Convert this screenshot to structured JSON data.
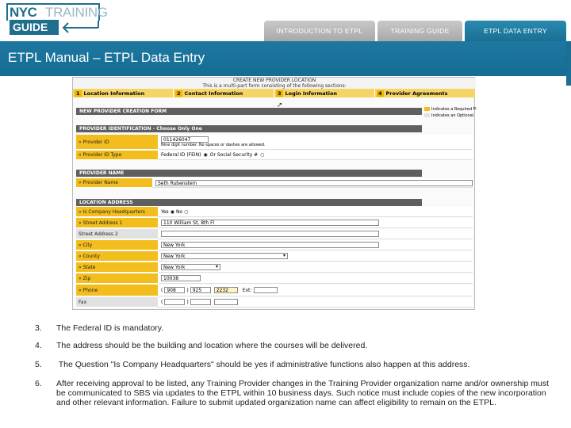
{
  "logo": {
    "line1_bold": "NYC",
    "line1_light": "TRAINING",
    "line2": "GUIDE"
  },
  "tabs": [
    {
      "label": "INTRODUCTION TO ETPL"
    },
    {
      "label": "TRAINING GUIDE"
    },
    {
      "label": "ETPL DATA ENTRY"
    }
  ],
  "page_title": "ETPL Manual – ETPL Data Entry",
  "colors": {
    "brand_blue": "#1e77a0",
    "form_label_yellow": "#f2bd1d",
    "step_bar": "#f5d565"
  },
  "form": {
    "header_line1": "CREATE NEW PROVIDER LOCATION",
    "header_line2": "This is a multi-part form consisting of the following sections:",
    "steps": [
      {
        "num": "1",
        "label": "Location Information"
      },
      {
        "num": "2",
        "label": "Contact Information"
      },
      {
        "num": "3",
        "label": "Login Information"
      },
      {
        "num": "4",
        "label": "Provider Agreements"
      }
    ],
    "legend": [
      "Indicates a Required Fi",
      "Indicates an Optional"
    ],
    "section_creation": "NEW PROVIDER CREATION FORM",
    "section_identification": "PROVIDER IDENTIFICATION - Choose Only One",
    "provider_id_label": "» Provider ID",
    "provider_id_value": "011426047",
    "provider_id_note": "Nine digit number. No spaces or dashes are allowed.",
    "provider_id_type_label": "» Provider ID Type",
    "provider_id_type_opt1": "Federal ID (FEIN)",
    "provider_id_type_opt2": "Or Social Security #",
    "section_name": "PROVIDER NAME",
    "provider_name_label": "» Provider Name",
    "provider_name_value": "Seth Rubenstein",
    "section_location": "LOCATION ADDRESS",
    "hq_label": "» Is Company Headquarters",
    "hq_yes": "Yes",
    "hq_no": "No",
    "street1_label": "» Street Address 1",
    "street1_value": "110 William St, 8th Fl",
    "street2_label": "Street Address 2",
    "city_label": "» City",
    "city_value": "New York",
    "county_label": "» County",
    "county_value": "New York",
    "state_label": "» State",
    "state_value": "New York",
    "zip_label": "» Zip",
    "zip_value": "10038",
    "phone_label": "» Phone",
    "phone_area": "908",
    "phone_prefix": "925",
    "phone_line": "2232",
    "ext_label": "Ext:",
    "fax_label": "Fax"
  },
  "notes": [
    {
      "num": "3.",
      "text": "The Federal ID is mandatory."
    },
    {
      "num": "4.",
      "text": "The address should be the building and location where the courses will be delivered."
    },
    {
      "num": "5.",
      "text": " The Question \"Is Company Headquarters\" should be yes if administrative functions also happen at this address."
    },
    {
      "num": "6.",
      "text": "After receiving approval to be listed, any Training Provider changes in the Training Provider organization name and/or ownership must be communicated to SBS via updates to the ETPL within 10 business days. Such notice must include copies of the new incorporation and other relevant information. Failure to submit updated organization name can affect eligibility to remain on the ETPL."
    }
  ]
}
